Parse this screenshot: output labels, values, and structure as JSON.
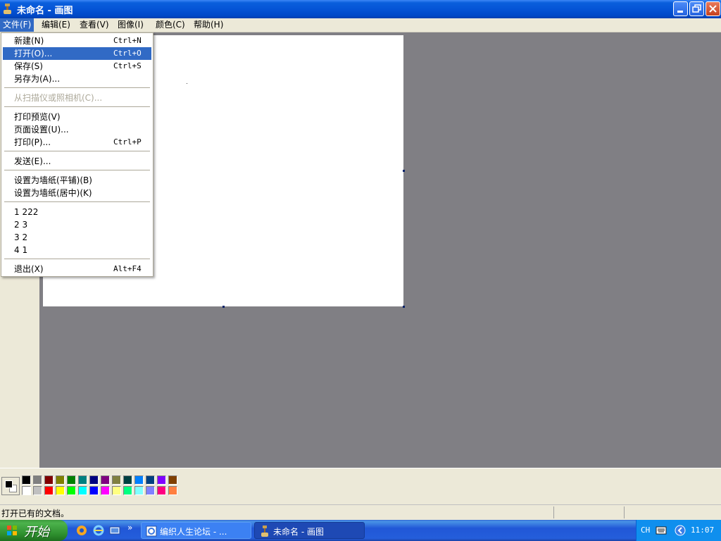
{
  "window": {
    "title": "未命名 - 画图"
  },
  "menubar": {
    "items": [
      "文件(F)",
      "编辑(E)",
      "查看(V)",
      "图像(I)",
      "颜色(C)",
      "帮助(H)"
    ]
  },
  "file_menu": {
    "items": [
      {
        "label": "新建(N)",
        "shortcut": "Ctrl+N"
      },
      {
        "label": "打开(O)...",
        "shortcut": "Ctrl+O"
      },
      {
        "label": "保存(S)",
        "shortcut": "Ctrl+S"
      },
      {
        "label": "另存为(A)...",
        "shortcut": ""
      },
      {
        "label": "从扫描仪或照相机(C)...",
        "shortcut": ""
      },
      {
        "label": "打印预览(V)",
        "shortcut": ""
      },
      {
        "label": "页面设置(U)...",
        "shortcut": ""
      },
      {
        "label": "打印(P)...",
        "shortcut": "Ctrl+P"
      },
      {
        "label": "发送(E)...",
        "shortcut": ""
      },
      {
        "label": "设置为墙纸(平铺)(B)",
        "shortcut": ""
      },
      {
        "label": "设置为墙纸(居中)(K)",
        "shortcut": ""
      },
      {
        "label": "1 222",
        "shortcut": ""
      },
      {
        "label": "2 3",
        "shortcut": ""
      },
      {
        "label": "3 2",
        "shortcut": ""
      },
      {
        "label": "4 1",
        "shortcut": ""
      },
      {
        "label": "退出(X)",
        "shortcut": "Alt+F4"
      }
    ]
  },
  "palette": {
    "top_row": [
      "#000000",
      "#808080",
      "#800000",
      "#808000",
      "#008000",
      "#008080",
      "#000080",
      "#800080",
      "#808040",
      "#004040",
      "#0080ff",
      "#004080",
      "#8000ff",
      "#804000"
    ],
    "bottom_row": [
      "#ffffff",
      "#c0c0c0",
      "#ff0000",
      "#ffff00",
      "#00ff00",
      "#00ffff",
      "#0000ff",
      "#ff00ff",
      "#ffff80",
      "#00ff80",
      "#80ffff",
      "#8080ff",
      "#ff0080",
      "#ff8040"
    ]
  },
  "status": {
    "text": "打开已有的文档。"
  },
  "taskbar": {
    "start_label": "开始",
    "tasks": [
      "编织人生论坛 - ...",
      "未命名 - 画图"
    ],
    "tray_lang": "CH",
    "clock": "11:07"
  }
}
